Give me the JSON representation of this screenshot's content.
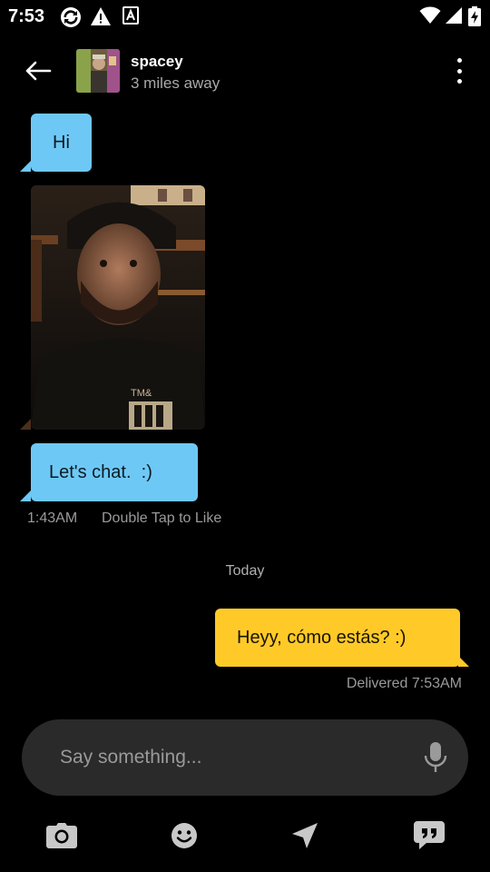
{
  "status_bar": {
    "time": "7:53",
    "icons": [
      "sync-icon",
      "warning-icon",
      "text-a-icon",
      "wifi-icon",
      "signal-icon",
      "battery-charging-icon"
    ]
  },
  "header": {
    "back_icon": "arrow-left-icon",
    "name": "spacey",
    "distance": "3 miles away",
    "menu_icon": "more-vertical-icon"
  },
  "messages": [
    {
      "direction": "incoming",
      "type": "text",
      "text": "Hi"
    },
    {
      "direction": "incoming",
      "type": "photo"
    },
    {
      "direction": "incoming",
      "type": "text",
      "text": "Let's chat.  :)"
    }
  ],
  "incoming_meta": {
    "time": "1:43AM",
    "hint": "Double Tap to Like"
  },
  "day_divider": "Today",
  "outgoing": {
    "text": "Heyy, cómo estás? :)",
    "status": "Delivered 7:53AM"
  },
  "composer": {
    "placeholder": "Say something...",
    "mic_icon": "microphone-icon"
  },
  "toolbar": {
    "items": [
      "camera-icon",
      "emoji-icon",
      "location-arrow-icon",
      "saved-phrases-icon"
    ]
  },
  "colors": {
    "background": "#000000",
    "incoming_bubble": "#6ec8f5",
    "outgoing_bubble": "#ffca28",
    "composer_bg": "#2a2a2a",
    "meta_text": "#9a9a9a"
  }
}
